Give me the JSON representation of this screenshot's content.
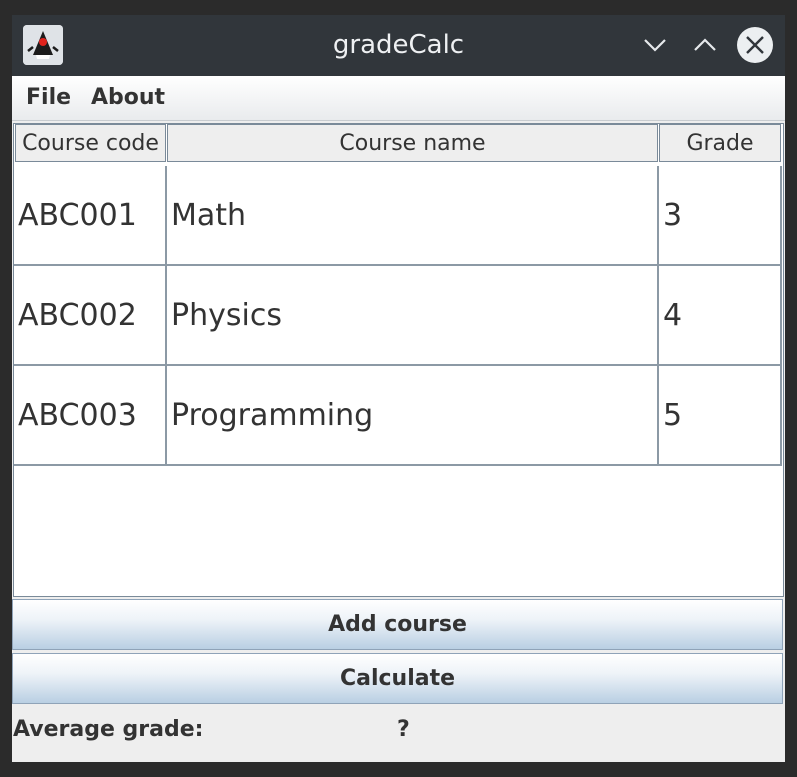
{
  "window": {
    "title": "gradeCalc",
    "icon": "java-duke-icon"
  },
  "menu": {
    "items": [
      {
        "label": "File"
      },
      {
        "label": "About"
      }
    ]
  },
  "table": {
    "columns": [
      "Course code",
      "Course name",
      "Grade"
    ],
    "rows": [
      {
        "code": "ABC001",
        "name": "Math",
        "grade": "3"
      },
      {
        "code": "ABC002",
        "name": "Physics",
        "grade": "4"
      },
      {
        "code": "ABC003",
        "name": "Programming",
        "grade": "5"
      }
    ]
  },
  "buttons": {
    "add_course": "Add course",
    "calculate": "Calculate"
  },
  "result": {
    "label": "Average grade:",
    "value": "?"
  },
  "colors": {
    "titlebar": "#31363b",
    "button_gradient_end": "#b9cfe3",
    "grid_line": "#8c99a5"
  }
}
